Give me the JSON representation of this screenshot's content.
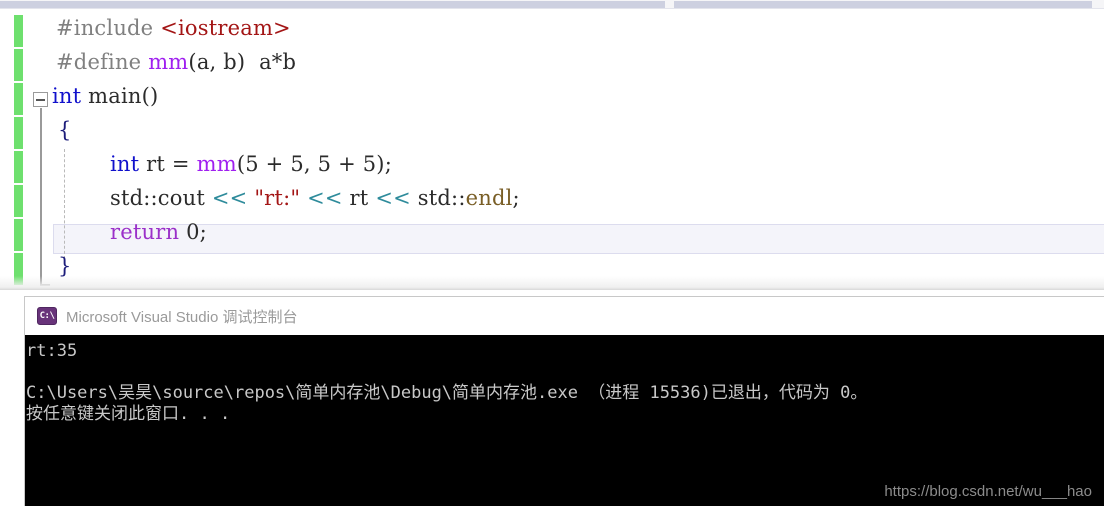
{
  "editor": {
    "scrollbar": {
      "name": "horizontal-scrollbar"
    },
    "change_bar_color": "#6ee06e",
    "current_line_index": 6,
    "code_lines": [
      {
        "indent": 0,
        "tokens": [
          {
            "text": "#include ",
            "cls": "t-pre"
          },
          {
            "text": "<iostream>",
            "cls": "t-str-ang"
          }
        ],
        "plain": "#include <iostream>"
      },
      {
        "indent": 0,
        "tokens": [
          {
            "text": "#define ",
            "cls": "t-pre"
          },
          {
            "text": "mm",
            "cls": "t-macro"
          },
          {
            "text": "(a, b) ",
            "cls": "t-plain"
          },
          {
            "text": " a*b",
            "cls": "t-plain"
          }
        ],
        "plain": "#define mm(a, b)  a*b"
      },
      {
        "indent": 0,
        "tokens": [
          {
            "text": "int",
            "cls": "t-kw"
          },
          {
            "text": " main()",
            "cls": "t-plain"
          }
        ],
        "plain": "int main()"
      },
      {
        "indent": 1,
        "tokens": [
          {
            "text": "{",
            "cls": "t-brace"
          }
        ],
        "plain": "{"
      },
      {
        "indent": 2,
        "tokens": [
          {
            "text": "int",
            "cls": "t-kw"
          },
          {
            "text": " rt ",
            "cls": "t-ident"
          },
          {
            "text": "= ",
            "cls": "t-plain"
          },
          {
            "text": "mm",
            "cls": "t-macro"
          },
          {
            "text": "(5 + 5, 5 + 5);",
            "cls": "t-plain"
          }
        ],
        "plain": "int rt = mm(5 + 5,  5 + 5);"
      },
      {
        "indent": 2,
        "tokens": [
          {
            "text": "std::cout ",
            "cls": "t-plain"
          },
          {
            "text": "<< ",
            "cls": "t-op"
          },
          {
            "text": "\"rt:\"",
            "cls": "t-str"
          },
          {
            "text": " << ",
            "cls": "t-op"
          },
          {
            "text": "rt ",
            "cls": "t-ident"
          },
          {
            "text": "<< ",
            "cls": "t-op"
          },
          {
            "text": "std::",
            "cls": "t-plain"
          },
          {
            "text": "endl",
            "cls": "t-fn"
          },
          {
            "text": ";",
            "cls": "t-plain"
          }
        ],
        "plain": "std::cout << \"rt:\" << rt << std::endl;"
      },
      {
        "indent": 2,
        "tokens": [
          {
            "text": "return",
            "cls": "t-kw2"
          },
          {
            "text": " 0;",
            "cls": "t-plain"
          }
        ],
        "plain": "return 0;"
      },
      {
        "indent": 1,
        "tokens": [
          {
            "text": "}",
            "cls": "t-brace"
          }
        ],
        "plain": "}"
      }
    ]
  },
  "console": {
    "title": "Microsoft Visual Studio 调试控制台",
    "icon_label": "C:\\",
    "icon_name": "console-app-icon",
    "output_lines": [
      "rt:35",
      "",
      "C:\\Users\\吴昊\\source\\repos\\简单内存池\\Debug\\简单内存池.exe （进程 15536)已退出，代码为 0。",
      "按任意键关闭此窗口. . ."
    ],
    "watermark": "https://blog.csdn.net/wu___hao"
  }
}
